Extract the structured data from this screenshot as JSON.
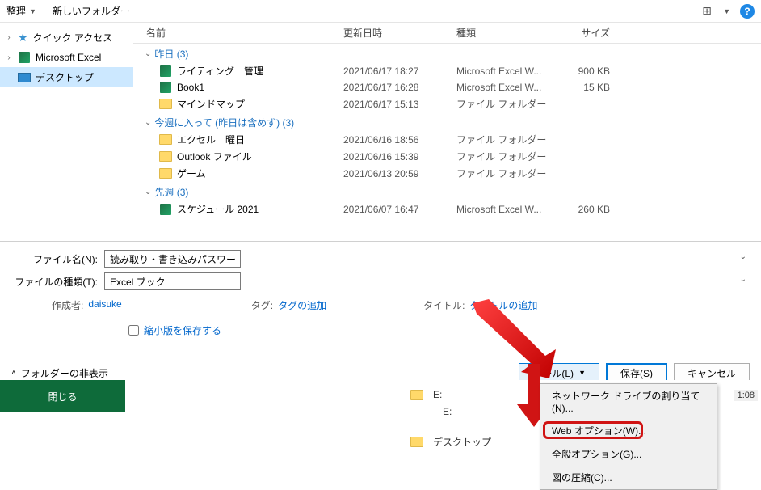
{
  "toolbar": {
    "organize": "整理",
    "new_folder": "新しいフォルダー"
  },
  "sidebar": {
    "items": [
      {
        "label": "クイック アクセス",
        "icon": "quick-access-icon"
      },
      {
        "label": "Microsoft Excel",
        "icon": "excel-icon"
      },
      {
        "label": "デスクトップ",
        "icon": "desktop-icon",
        "selected": true
      }
    ]
  },
  "columns": {
    "name": "名前",
    "date": "更新日時",
    "type": "種類",
    "size": "サイズ"
  },
  "groups": [
    {
      "label": "昨日 (3)",
      "rows": [
        {
          "name": "ライティング　管理",
          "icon": "excel",
          "date": "2021/06/17 18:27",
          "type": "Microsoft Excel W...",
          "size": "900 KB"
        },
        {
          "name": "Book1",
          "icon": "excel",
          "date": "2021/06/17 16:28",
          "type": "Microsoft Excel W...",
          "size": "15 KB"
        },
        {
          "name": "マインドマップ",
          "icon": "folder",
          "date": "2021/06/17 15:13",
          "type": "ファイル フォルダー",
          "size": ""
        }
      ]
    },
    {
      "label": "今週に入って (昨日は含めず) (3)",
      "rows": [
        {
          "name": "エクセル　曜日",
          "icon": "folder",
          "date": "2021/06/16 18:56",
          "type": "ファイル フォルダー",
          "size": ""
        },
        {
          "name": "Outlook ファイル",
          "icon": "folder",
          "date": "2021/06/16 15:39",
          "type": "ファイル フォルダー",
          "size": ""
        },
        {
          "name": "ゲーム",
          "icon": "folder",
          "date": "2021/06/13 20:59",
          "type": "ファイル フォルダー",
          "size": ""
        }
      ]
    },
    {
      "label": "先週 (3)",
      "rows": [
        {
          "name": "スケジュール 2021",
          "icon": "excel",
          "date": "2021/06/07 16:47",
          "type": "Microsoft Excel W...",
          "size": "260 KB"
        }
      ]
    }
  ],
  "filename": {
    "label": "ファイル名(N):",
    "value": "読み取り・書き込みパスワード"
  },
  "filetype": {
    "label": "ファイルの種類(T):",
    "value": "Excel ブック"
  },
  "meta": {
    "author_label": "作成者:",
    "author": "daisuke",
    "tag_label": "タグ:",
    "tag": "タグの追加",
    "title_label": "タイトル:",
    "title": "タイトルの追加"
  },
  "thumbnail": "縮小版を保存する",
  "hide_folders": "フォルダーの非表示",
  "buttons": {
    "tool": "ツール(L)",
    "save": "保存(S)",
    "cancel": "キャンセル"
  },
  "tool_menu": [
    "ネットワーク ドライブの割り当て(N)...",
    "Web オプション(W)...",
    "全般オプション(G)...",
    "図の圧縮(C)..."
  ],
  "close_panel": "閉じる",
  "under": {
    "e1": "E:",
    "e2": "E:",
    "desktop": "デスクトップ"
  },
  "time": "1:08"
}
